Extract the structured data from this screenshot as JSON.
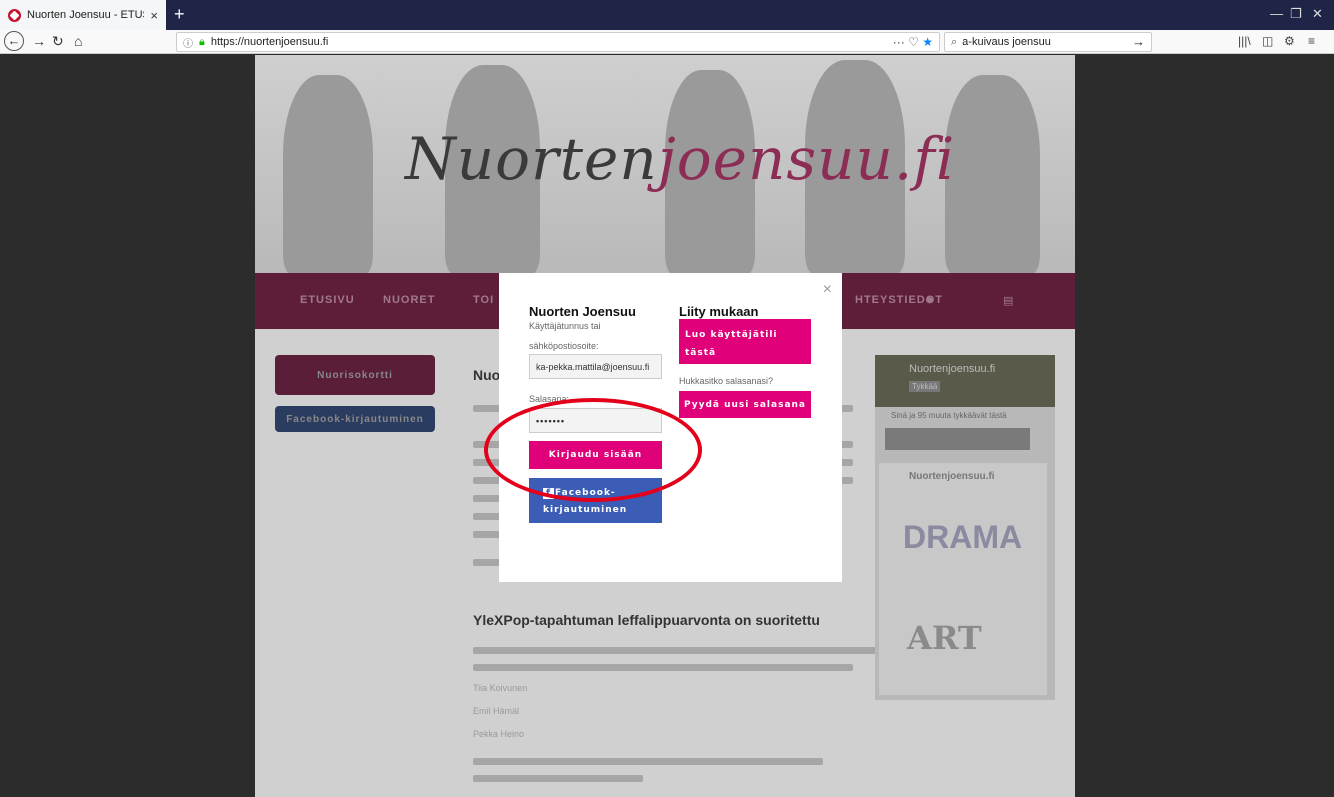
{
  "browser": {
    "tab_title": "Nuorten Joensuu - ETUSIVU",
    "tab_close": "×",
    "new_tab": "+",
    "url": "https://nuortenjoensuu.fi",
    "url_actions": "··· ♡",
    "search_value": "a-kuivaus joensuu"
  },
  "site": {
    "logo_prefix": "Nuorten",
    "logo_highlight": "joensuu",
    "logo_suffix": ".fi",
    "menu": [
      "ETUSIVU",
      "NUORET",
      "TOI",
      "HTEYSTIEDOT"
    ],
    "left_buttons": {
      "card": "Nuorisokortti",
      "facebook": "Facebook-kirjautuminen"
    },
    "article_partial": "Nuor",
    "article_title": "YleXPop-tapahtuman leffalippuarvonta on suoritettu",
    "article_names": [
      "Tiia Koivunen",
      "Emil Hämäl",
      "Pekka Heino"
    ],
    "fb_page": "Nuortenjoensuu.fi",
    "fb_like": "Tykkää",
    "fb_friends": "Sinä ja 95 muuta tykkäävät tästä",
    "fb_feed_name": "Nuortenjoensuu.fi",
    "drama": "DRAMA",
    "art": "ART"
  },
  "modal": {
    "close": "×",
    "title": "Nuorten Joensuu",
    "username_label_1": "Käyttäjätunnus tai",
    "username_label_2": "sähköpostiosoite:",
    "username_value": "ka-pekka.mattila@joensuu.fi",
    "password_label": "Salasana:",
    "password_value": "•••••••",
    "login_button": "Kirjaudu sisään",
    "facebook_button_1": "Facebook-",
    "facebook_button_2": "kirjautuminen",
    "join_title": "Liity mukaan",
    "create_button_1": "Luo käyttäjätili",
    "create_button_2": "tästä",
    "forgot_text": "Hukkasitko salasanasi?",
    "reset_button": "Pyydä uusi salasana"
  },
  "colors": {
    "accent": "#e0007a",
    "facebook": "#3b5db5",
    "annotation": "#e3001b",
    "tabbar": "#1f2546"
  }
}
